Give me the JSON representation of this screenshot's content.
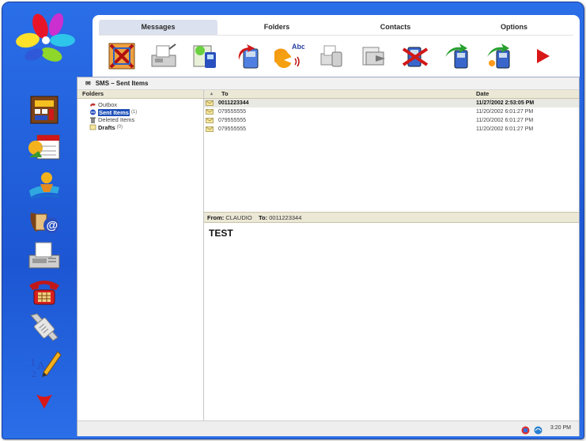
{
  "tabs": [
    {
      "label": "Messages",
      "active": true
    },
    {
      "label": "Folders",
      "active": false
    },
    {
      "label": "Contacts",
      "active": false
    },
    {
      "label": "Options",
      "active": false
    }
  ],
  "toolbar_icons": [
    "close-box-icon",
    "fax-machine-icon",
    "new-sms-icon",
    "reply-icon",
    "spell-check-icon",
    "print-icon",
    "forward-icon",
    "delete-icon",
    "send-icon",
    "receive-icon",
    "next-arrow-icon"
  ],
  "toolbar": {
    "spell_label": "Abc"
  },
  "sidebar_icons": [
    "calculator-icon",
    "calendar-icon",
    "pilot-icon",
    "email-icon",
    "fax-icon",
    "phone-icon",
    "handset-icon",
    "notes-icon",
    "more-arrow-icon"
  ],
  "breadcrumb": "SMS – Sent Items",
  "folders": {
    "header": "Folders",
    "items": [
      {
        "name": "Outbox",
        "count": ""
      },
      {
        "name": "Sent Items",
        "count": "(1)"
      },
      {
        "name": "Deleted Items",
        "count": ""
      },
      {
        "name": "Drafts",
        "count": "(0)"
      }
    ]
  },
  "message_list": {
    "columns": {
      "to": "To",
      "date": "Date"
    },
    "rows": [
      {
        "to": "0011223344",
        "date": "11/27/2002 2:53:05 PM"
      },
      {
        "to": "079555555",
        "date": "11/20/2002 6:01:27 PM"
      },
      {
        "to": "079555555",
        "date": "11/20/2002 6:01:27 PM"
      },
      {
        "to": "079555555",
        "date": "11/20/2002 6:01:27 PM"
      }
    ]
  },
  "preview": {
    "from_label": "From:",
    "from_value": "CLAUDIO",
    "to_label": "To:",
    "to_value": "0011223344",
    "body": "TEST"
  },
  "status": {
    "time": "3:20 PM"
  },
  "colors": {
    "frame": "#1d56d2",
    "selection": "#1f50b8",
    "header_bg": "#ebe8d6"
  }
}
